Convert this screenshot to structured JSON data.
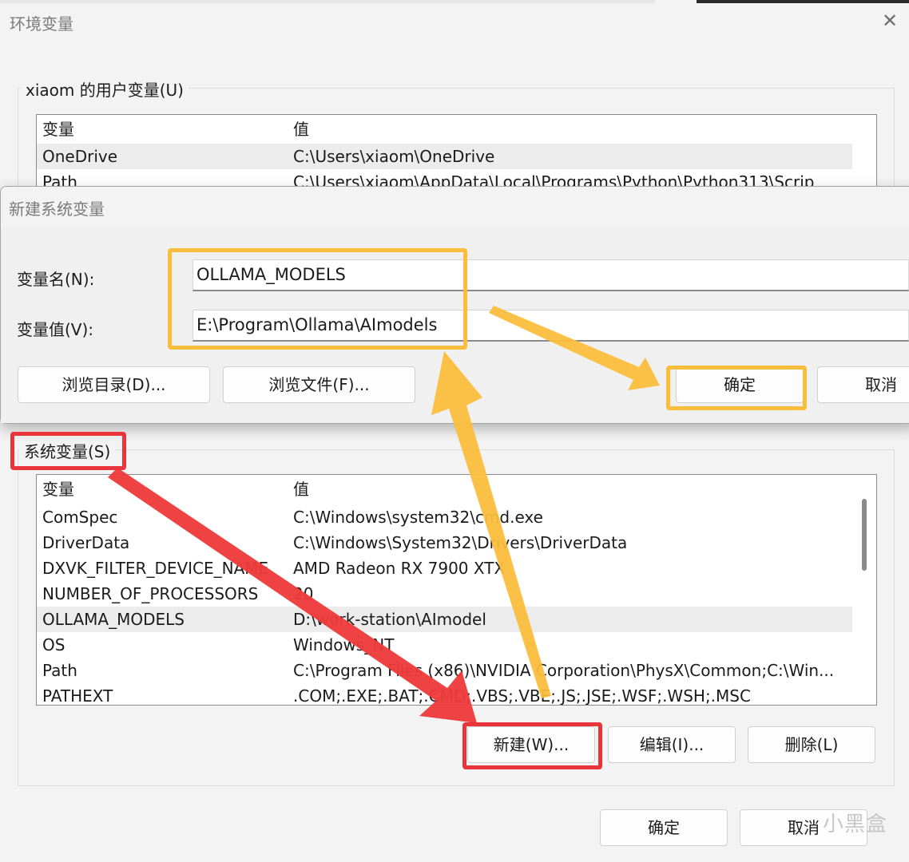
{
  "outer": {
    "title": "环境变量",
    "close_glyph": "✕",
    "user_group": {
      "label": "xiaom 的用户变量(U)",
      "headers": [
        "变量",
        "值"
      ],
      "rows": [
        {
          "name": "OneDrive",
          "value": "C:\\Users\\xiaom\\OneDrive"
        },
        {
          "name": "Path",
          "value": "C:\\Users\\xiaom\\AppData\\Local\\Programs\\Python\\Python313\\Scrip"
        }
      ]
    },
    "system_group": {
      "label": "系统变量(S)",
      "headers": [
        "变量",
        "值"
      ],
      "rows": [
        {
          "name": "ComSpec",
          "value": "C:\\Windows\\system32\\cmd.exe"
        },
        {
          "name": "DriverData",
          "value": "C:\\Windows\\System32\\Drivers\\DriverData"
        },
        {
          "name": "DXVK_FILTER_DEVICE_NAME",
          "value": "AMD Radeon RX 7900 XTX"
        },
        {
          "name": "NUMBER_OF_PROCESSORS",
          "value": "20"
        },
        {
          "name": "OLLAMA_MODELS",
          "value": "D:\\work-station\\AImodel"
        },
        {
          "name": "OS",
          "value": "Windows_NT"
        },
        {
          "name": "Path",
          "value": "C:\\Program Files (x86)\\NVIDIA Corporation\\PhysX\\Common;C:\\Win..."
        },
        {
          "name": "PATHEXT",
          "value": ".COM;.EXE;.BAT;.CMD;.VBS;.VBE;.JS;.JSE;.WSF;.WSH;.MSC"
        }
      ],
      "buttons": {
        "new": "新建(W)...",
        "edit": "编辑(I)...",
        "delete": "删除(L)"
      }
    },
    "footer": {
      "ok": "确定",
      "cancel": "取消"
    }
  },
  "new_dialog": {
    "title": "新建系统变量",
    "name_label": "变量名(N):",
    "value_label": "变量值(V):",
    "name_value": "OLLAMA_MODELS",
    "value_value": "E:\\Program\\Ollama\\AImodels",
    "browse_dir": "浏览目录(D)...",
    "browse_file": "浏览文件(F)...",
    "ok": "确定",
    "cancel": "取消"
  },
  "annotations": {
    "yellow": "#fbbd3c",
    "red": "#e8343a"
  },
  "watermark": "小黑盒"
}
